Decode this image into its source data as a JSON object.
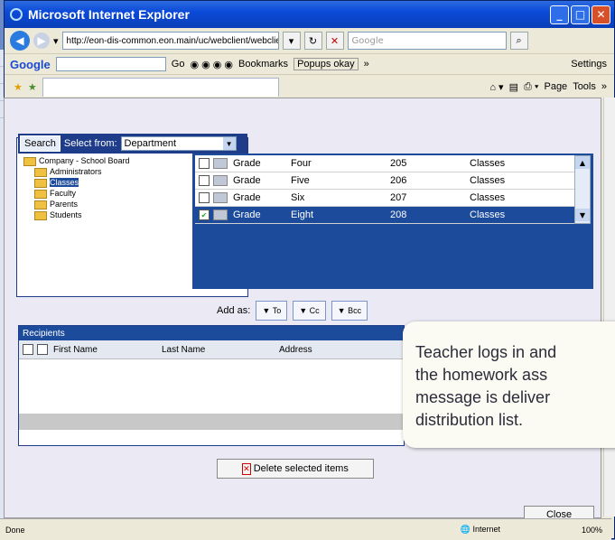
{
  "window": {
    "title": "Microsoft Internet Explorer"
  },
  "address_bar": {
    "url": "http://eon-dis-common.eon.main/uc/webclient/webclier",
    "search_placeholder": "Google"
  },
  "google_toolbar": {
    "logo": "Google",
    "go_label": "Go",
    "bookmarks": "Bookmarks",
    "popups": "Popups okay",
    "more": "»",
    "settings": "Settings"
  },
  "fav_toolbar": {
    "page_label": "Page",
    "tools_label": "Tools",
    "more": "»"
  },
  "search_panel": {
    "tab_label": "Search",
    "select_from_label": "Select from:",
    "select_value": "Department"
  },
  "tree": [
    {
      "label": "Company - School Board",
      "selected": false
    },
    {
      "label": "Administrators",
      "selected": false
    },
    {
      "label": "Classes",
      "selected": true
    },
    {
      "label": "Faculty",
      "selected": false
    },
    {
      "label": "Parents",
      "selected": false
    },
    {
      "label": "Students",
      "selected": false
    }
  ],
  "grid_rows": [
    {
      "col1": "Grade",
      "col2": "Four",
      "col3": "205",
      "col4": "Classes",
      "checked": false,
      "highlight": false
    },
    {
      "col1": "Grade",
      "col2": "Five",
      "col3": "206",
      "col4": "Classes",
      "checked": false,
      "highlight": false
    },
    {
      "col1": "Grade",
      "col2": "Six",
      "col3": "207",
      "col4": "Classes",
      "checked": false,
      "highlight": false
    },
    {
      "col1": "Grade",
      "col2": "Eight",
      "col3": "208",
      "col4": "Classes",
      "checked": true,
      "highlight": true
    }
  ],
  "add_as": {
    "label": "Add as:",
    "to": "To",
    "cc": "Cc",
    "bcc": "Bcc"
  },
  "recipients": {
    "tab_label": "Recipients",
    "columns": [
      "First Name",
      "Last Name",
      "Address"
    ]
  },
  "delete_button": "Delete selected items",
  "close_button": "Close",
  "status_bar": {
    "left": "Done",
    "zone": "Internet",
    "zoom": "100%"
  },
  "callout": {
    "lines": [
      "Teacher logs in and",
      "the homework ass",
      "message is deliver",
      "distribution list."
    ]
  }
}
